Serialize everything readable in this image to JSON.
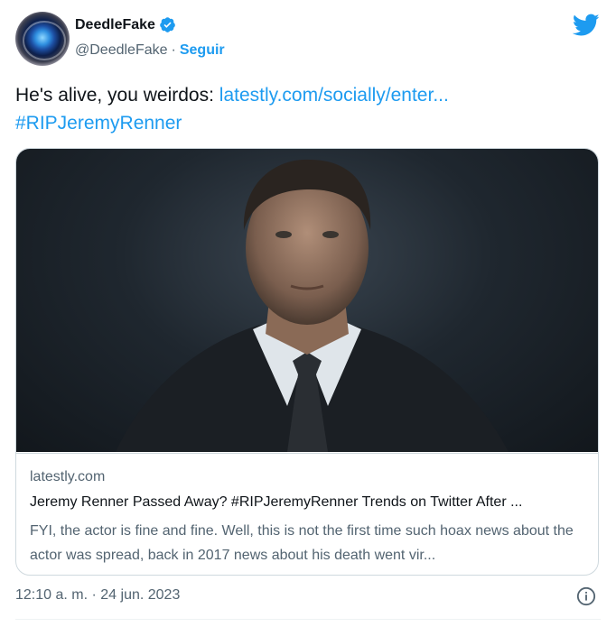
{
  "author": {
    "display_name": "DeedleFake",
    "handle": "@DeedleFake",
    "separator": "·",
    "follow_label": "Seguir"
  },
  "tweet": {
    "text": "He's alive, you weirdos: ",
    "link_text": "latestly.com/socially/enter...",
    "hashtag": "#RIPJeremyRenner"
  },
  "card": {
    "domain": "latestly.com",
    "title": "Jeremy Renner Passed Away? #RIPJeremyRenner Trends on Twitter After ...",
    "description": "FYI, the actor is fine and fine. Well, this is not the first time such hoax news about the actor was spread, back in 2017 news about his death went vir..."
  },
  "footer": {
    "timestamp": "12:10 a. m. · 24 jun. 2023"
  },
  "colors": {
    "link": "#1d9bf0",
    "text": "#0f1419",
    "muted": "#536471"
  },
  "icons": [
    "verified-badge-icon",
    "twitter-bird-icon",
    "info-icon"
  ]
}
